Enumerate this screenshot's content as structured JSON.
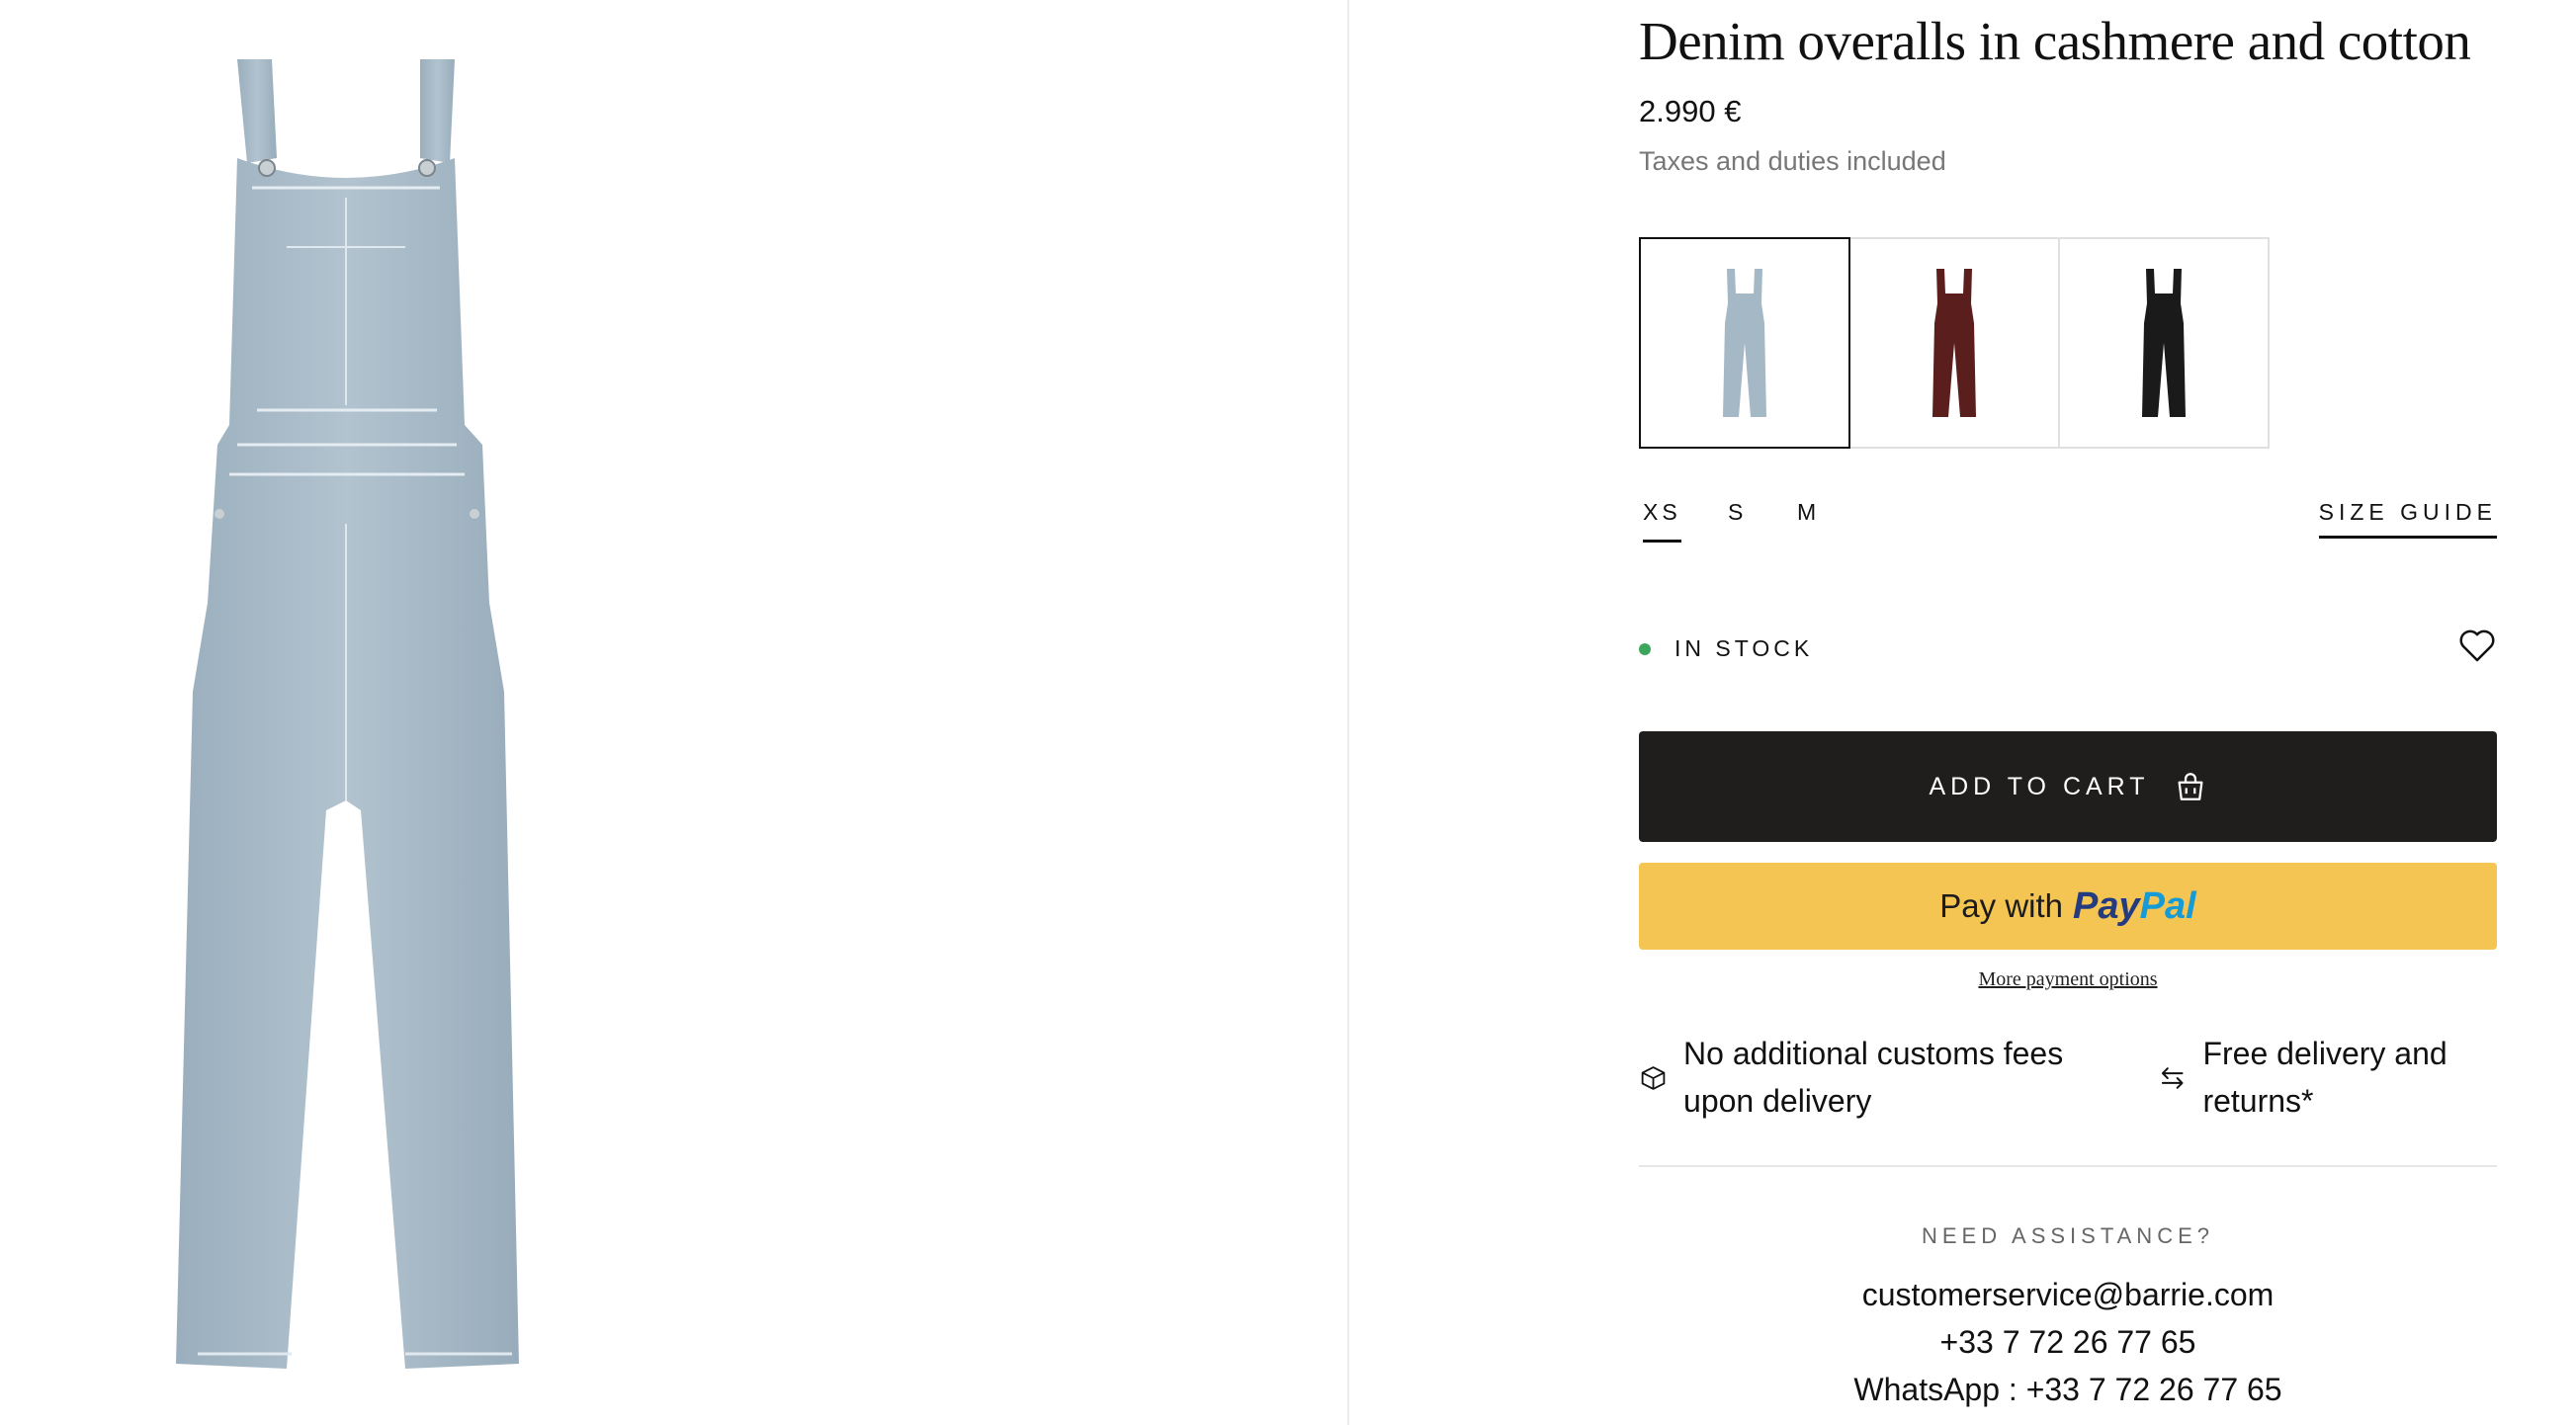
{
  "product": {
    "title": "Denim overalls in cashmere and cotton",
    "price": "2.990 €",
    "tax_note": "Taxes and duties included"
  },
  "colors": {
    "swatches": [
      {
        "name": "light-blue",
        "hex": "#a5b8c6",
        "selected": true
      },
      {
        "name": "burgundy",
        "hex": "#5a1f1d",
        "selected": false
      },
      {
        "name": "black",
        "hex": "#1a1a1a",
        "selected": false
      }
    ],
    "accent_stock": "#3ba55c",
    "button_dark": "#1f1e1c",
    "paypal_yellow": "#f4c552"
  },
  "sizes": {
    "options": [
      "XS",
      "S",
      "M"
    ],
    "selected": "XS",
    "guide_label": "SIZE GUIDE"
  },
  "stock": {
    "label": "IN STOCK"
  },
  "cart": {
    "label": "ADD TO CART",
    "icon": "shopping-bag-icon"
  },
  "paypal": {
    "prefix": "Pay with",
    "brand_pay": "Pay",
    "brand_pal": "Pal"
  },
  "more_payment_options": "More payment options",
  "features": [
    {
      "icon": "box-icon",
      "text": "No additional customs fees upon delivery"
    },
    {
      "icon": "exchange-arrows-icon",
      "text": "Free delivery and returns*"
    }
  ],
  "assistance": {
    "heading": "NEED ASSISTANCE?",
    "email": "customerservice@barrie.com",
    "phone": "+33 7 72 26 77 65",
    "whatsapp": "WhatsApp : +33 7 72 26 77 65"
  }
}
